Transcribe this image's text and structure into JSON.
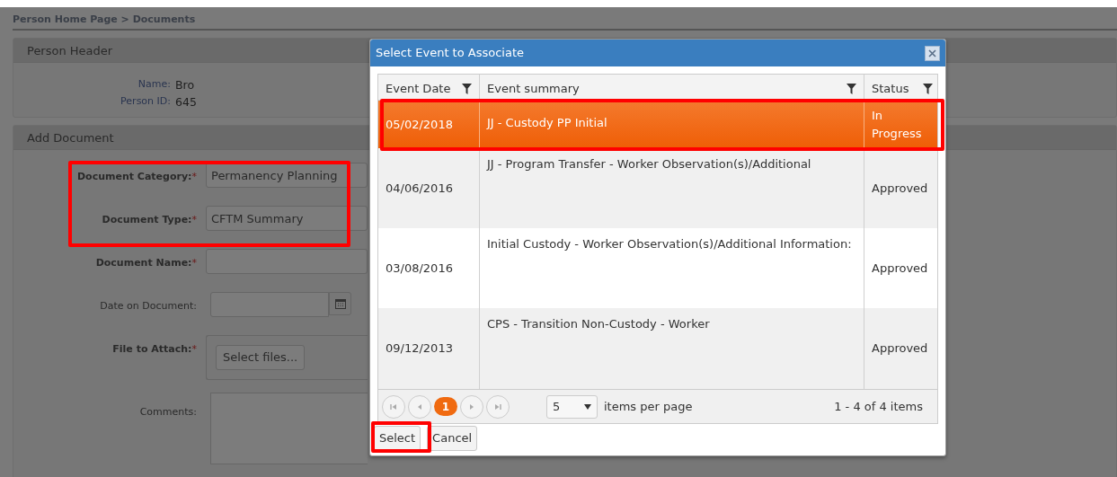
{
  "breadcrumb": "Person Home Page > Documents",
  "person_header": {
    "title": "Person Header",
    "fields": [
      {
        "label": "Name:",
        "value": "Bro"
      },
      {
        "label": "Person ID:",
        "value": "645"
      }
    ]
  },
  "add_document": {
    "title": "Add Document",
    "fields": [
      {
        "kind": "select",
        "label": "Document Category:",
        "required_mark": "*",
        "value": "Permanency Planning"
      },
      {
        "kind": "select",
        "label": "Document Type:",
        "required_mark": "*",
        "value": "CFTM Summary"
      },
      {
        "kind": "text",
        "label": "Document Name:",
        "required_mark": "*"
      },
      {
        "kind": "date",
        "label": "Date on Document:"
      },
      {
        "kind": "file",
        "label": "File to Attach:",
        "required_mark": "*",
        "button": "Select files..."
      },
      {
        "kind": "textarea",
        "label": "Comments:"
      }
    ]
  },
  "dialog": {
    "title": "Select Event to Associate",
    "columns": [
      "Event Date",
      "Event summary",
      "Status"
    ],
    "rows": [
      {
        "date": "05/02/2018",
        "summary": "JJ - Custody PP Initial",
        "status": "In Progress",
        "selected": true
      },
      {
        "date": "04/06/2016",
        "summary": "JJ - Program Transfer - Worker Observation(s)/Additional",
        "status": "Approved",
        "selected": false
      },
      {
        "date": "03/08/2016",
        "summary": "Initial Custody - Worker Observation(s)/Additional Information:",
        "status": "Approved",
        "selected": false
      },
      {
        "date": "09/12/2013",
        "summary": "CPS - Transition Non-Custody - Worker",
        "status": "Approved",
        "selected": false
      }
    ],
    "pager": {
      "page": "1",
      "page_size": "5",
      "page_size_label": "items per page",
      "summary": "1 - 4 of 4 items"
    },
    "buttons": [
      "Select",
      "Cancel"
    ]
  }
}
